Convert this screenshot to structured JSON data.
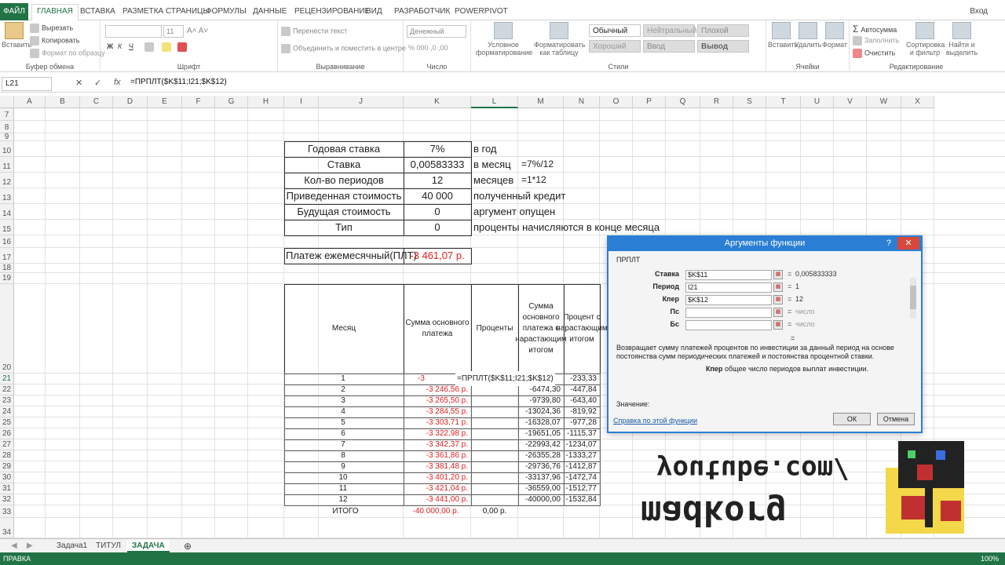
{
  "ribbon_tabs": {
    "file": "ФАЙЛ",
    "items": [
      "ГЛАВНАЯ",
      "ВСТАВКА",
      "РАЗМЕТКА СТРАНИЦЫ",
      "ФОРМУЛЫ",
      "ДАННЫЕ",
      "РЕЦЕНЗИРОВАНИЕ",
      "ВИД",
      "РАЗРАБОТЧИК",
      "POWERPIVOT"
    ],
    "login": "Вход"
  },
  "ribbon": {
    "clipboard": {
      "paste": "Вставить",
      "cut": "Вырезать",
      "copy": "Копировать",
      "format_painter": "Формат по образцу",
      "label": "Буфер обмена"
    },
    "font": {
      "size": "11",
      "bold": "Ж",
      "italic": "К",
      "underline": "Ч",
      "label": "Шрифт"
    },
    "alignment": {
      "wrap": "Перенести текст",
      "merge": "Объединить и поместить в центре",
      "label": "Выравнивание"
    },
    "number": {
      "format": "Денежный",
      "label": "Число"
    },
    "styles": {
      "conditional": "Условное форматирование",
      "as_table": "Форматировать как таблицу",
      "normal": "Обычный",
      "neutral": "Нейтральный",
      "bad": "Плохой",
      "good": "Хороший",
      "input": "Ввод",
      "output": "Вывод",
      "label": "Стили"
    },
    "cells": {
      "insert": "Вставить",
      "delete": "Удалить",
      "format": "Формат",
      "label": "Ячейки"
    },
    "editing": {
      "autosum": "Автосумма",
      "fill": "Заполнить",
      "clear": "Очистить",
      "sort": "Сортировка и фильтр",
      "find": "Найти и выделить",
      "label": "Редактирование"
    }
  },
  "formula_bar": {
    "name_box": "L21",
    "cancel": "✕",
    "enter": "✓",
    "fx": "fx",
    "formula": "=ПРПЛТ($K$11;I21;$K$12)"
  },
  "columns": [
    "A",
    "B",
    "C",
    "D",
    "E",
    "F",
    "G",
    "H",
    "I",
    "J",
    "K",
    "L",
    "M",
    "N",
    "O",
    "P",
    "Q",
    "R",
    "S",
    "T",
    "U",
    "V",
    "W",
    "X"
  ],
  "rows": [
    "7",
    "8",
    "9",
    "10",
    "11",
    "12",
    "13",
    "14",
    "15",
    "16",
    "17",
    "18",
    "19",
    "20",
    "21",
    "22",
    "23",
    "24",
    "25",
    "26",
    "27",
    "28",
    "29",
    "30",
    "31",
    "32",
    "33",
    "34"
  ],
  "params": [
    {
      "label": "Годовая ставка",
      "value": "7%",
      "note": "в год",
      "extra": ""
    },
    {
      "label": "Ставка",
      "value": "0,00583333",
      "note": "в месяц",
      "extra": "=7%/12"
    },
    {
      "label": "Кол-во периодов",
      "value": "12",
      "note": "месяцев",
      "extra": "=1*12"
    },
    {
      "label": "Приведенная стоимость",
      "value": "40 000",
      "note": "полученный кредит",
      "extra": ""
    },
    {
      "label": "Будущая стоимость",
      "value": "0",
      "note": "аргумент опущен",
      "extra": ""
    },
    {
      "label": "Тип",
      "value": "0",
      "note": "проценты начисляются в конце месяца",
      "extra": ""
    }
  ],
  "payment": {
    "label": "Платеж ежемесячный(ПЛТ)",
    "value": "-3 461,07 р."
  },
  "table": {
    "headers": [
      "Месяц",
      "Сумма основного платежа",
      "Проценты",
      "Сумма основного платежа с нарастающим итогом",
      "Процент с нарастающим итогом"
    ],
    "rows": [
      [
        "1",
        "-3",
        "",
        "",
        "-233,33"
      ],
      [
        "2",
        "-3 246,56 р.",
        "",
        "-6474,30",
        "-447,84"
      ],
      [
        "3",
        "-3 265,50 р.",
        "",
        "-9739,80",
        "-643,40"
      ],
      [
        "4",
        "-3 284,55 р.",
        "",
        "-13024,36",
        "-819,92"
      ],
      [
        "5",
        "-3 303,71 р.",
        "",
        "-16328,07",
        "-977,28"
      ],
      [
        "6",
        "-3 322,98 р.",
        "",
        "-19651,05",
        "-1115,37"
      ],
      [
        "7",
        "-3 342,37 р.",
        "",
        "-22993,42",
        "-1234,07"
      ],
      [
        "8",
        "-3 361,86 р.",
        "",
        "-26355,28",
        "-1333,27"
      ],
      [
        "9",
        "-3 381,48 р.",
        "",
        "-29736,76",
        "-1412,87"
      ],
      [
        "10",
        "-3 401,20 р.",
        "",
        "-33137,96",
        "-1472,74"
      ],
      [
        "11",
        "-3 421,04 р.",
        "",
        "-36559,00",
        "-1512,77"
      ],
      [
        "12",
        "-3 441,00 р.",
        "",
        "-40000,00",
        "-1532,84"
      ]
    ],
    "total": {
      "label": "ИТОГО",
      "main": "-40 000,00 р.",
      "interest": "0,00 р."
    },
    "editing_formula": "=ПРПЛТ($K$11;I21;$K$12)"
  },
  "dialog": {
    "title": "Аргументы функции",
    "help": "?",
    "close": "✕",
    "function": "ПРПЛТ",
    "args": [
      {
        "label": "Ставка",
        "input": "$K$11",
        "result": "0,005833333",
        "muted": false
      },
      {
        "label": "Период",
        "input": "I21",
        "result": "1",
        "muted": false
      },
      {
        "label": "Кпер",
        "input": "$K$12",
        "result": "12",
        "muted": false
      },
      {
        "label": "Пс",
        "input": "",
        "result": "число",
        "muted": true
      },
      {
        "label": "Бс",
        "input": "",
        "result": "число",
        "muted": true
      }
    ],
    "equals": "=",
    "description": "Возвращает сумму платежей процентов по инвестиции за данный период на основе постоянства сумм периодических платежей и постоянства процентной ставки.",
    "arg_help_label": "Кпер",
    "arg_help_text": "общее число периодов выплат инвестиции.",
    "value_label": "Значение:",
    "help_link": "Справка по этой функции",
    "ok": "ОК",
    "cancel": "Отмена"
  },
  "sheets": {
    "items": [
      "Задача1",
      "ТИТУЛ",
      "ЗАДАЧА"
    ],
    "active": 2
  },
  "status": {
    "mode": "ПРАВКА",
    "zoom": "100%"
  },
  "watermark": {
    "line1": "youtube.com/",
    "line2": "madkorg"
  },
  "colors": {
    "excel_green": "#217346",
    "dialog_blue": "#2a7fd4",
    "negative_red": "#e02020"
  }
}
